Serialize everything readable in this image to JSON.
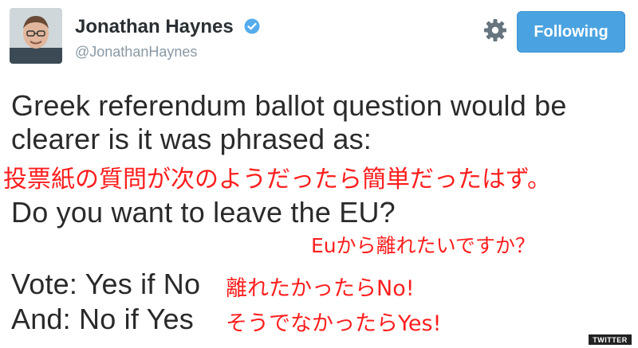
{
  "profile": {
    "display_name": "Jonathan Haynes",
    "handle": "@JonathanHaynes",
    "verified_icon": "verified-badge-icon",
    "avatar_icon": "avatar"
  },
  "actions": {
    "settings_icon": "gear-icon",
    "follow_label": "Following"
  },
  "tweet": {
    "line1": "Greek referendum ballot question would be",
    "line2": "clearer is it was phrased as:",
    "line3": "Do you want to leave the EU?",
    "line4": "Vote: Yes if No",
    "line5": "And: No if Yes"
  },
  "annotations": {
    "jp1": "投票紙の質問が次のようだったら簡単だったはず。",
    "jp2": "Euから離れたいですか？",
    "jp3": "離れたかったらNo!",
    "jp4": "そうでなかったらYes!"
  },
  "watermark": "TWITTER",
  "colors": {
    "follow_button": "#4aa3e0",
    "annotation_red": "#ff1e1e",
    "handle_gray": "#8899a6",
    "verified_blue": "#55acee"
  }
}
